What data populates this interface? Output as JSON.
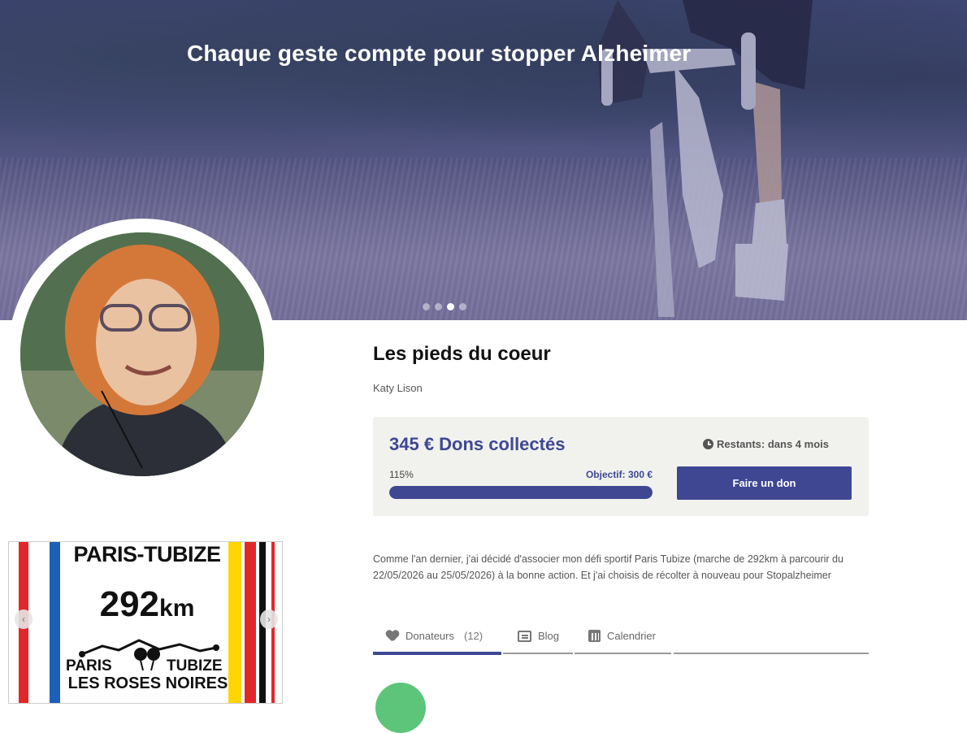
{
  "hero": {
    "title": "Chaque geste compte pour stopper Alzheimer",
    "slides": {
      "count": 4,
      "active_index": 2
    }
  },
  "profile": {
    "photo": "organizer-photo"
  },
  "campaign": {
    "title": "Les pieds du coeur",
    "author": "Katy Lison",
    "amount_label": "345 € Dons collectés",
    "remaining_label": "Restants: dans 4 mois",
    "progress_percent_label": "115%",
    "progress_fraction": 1.0,
    "goal_label": "Objectif: 300 €",
    "donate_button": "Faire un don",
    "description": "Comme l'an dernier, j'ai décidé d'associer mon défi sportif Paris Tubize (marche de 292km à parcourir du 22/05/2026 au 25/05/2026) à la bonne action. Et j'ai choisis de récolter à nouveau pour Stopalzheimer"
  },
  "tabs": [
    {
      "label": "Donateurs",
      "count": "(12)",
      "icon": "heart-icon",
      "active": true
    },
    {
      "label": "Blog",
      "icon": "newspaper-icon",
      "active": false
    },
    {
      "label": "Calendrier",
      "icon": "calendar-icon",
      "active": false
    }
  ],
  "poster": {
    "title": "PARIS-TUBIZE",
    "distance": "292",
    "unit": "km",
    "left_city": "PARIS",
    "right_city": "TUBIZE",
    "subtitle": "LES ROSES NOIRES"
  },
  "colors": {
    "primary": "#3f4793",
    "card_bg": "#f1f2ee",
    "avatar_placeholder_green": "#5cc57a"
  }
}
